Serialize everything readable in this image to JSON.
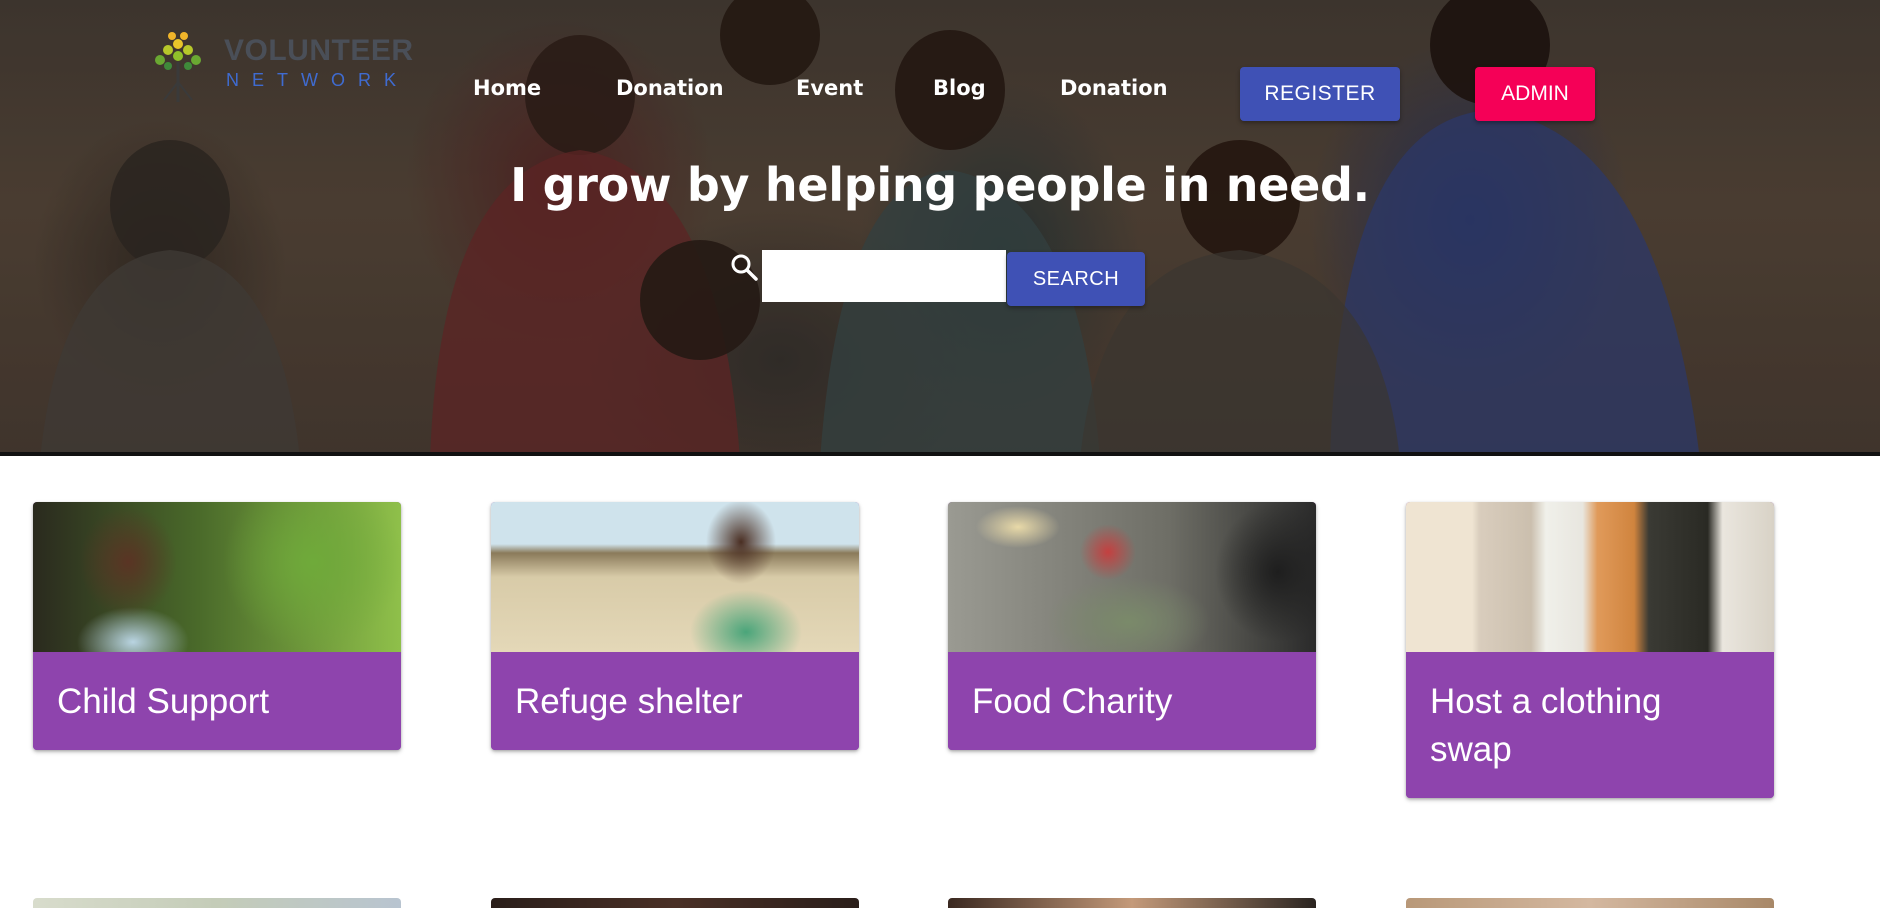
{
  "logo": {
    "word1": "VOLUNTEER",
    "word2": "NETWORK",
    "icon": "tree-logo-icon"
  },
  "nav": {
    "links": [
      "Home",
      "Donation",
      "Event",
      "Blog",
      "Donation"
    ],
    "register_label": "REGISTER",
    "admin_label": "ADMIN"
  },
  "hero": {
    "headline": "I grow by helping people in need.",
    "search": {
      "value": "",
      "placeholder": "",
      "button_label": "SEARCH",
      "icon": "search-icon"
    }
  },
  "cards": [
    {
      "title": "Child Support"
    },
    {
      "title": "Refuge shelter"
    },
    {
      "title": "Food Charity"
    },
    {
      "title": "Host a clothing swap"
    }
  ],
  "colors": {
    "primary": "#3f51b5",
    "secondary": "#f50057",
    "card_accent": "#8e44ad",
    "logo_blue": "#3f6bd0"
  }
}
